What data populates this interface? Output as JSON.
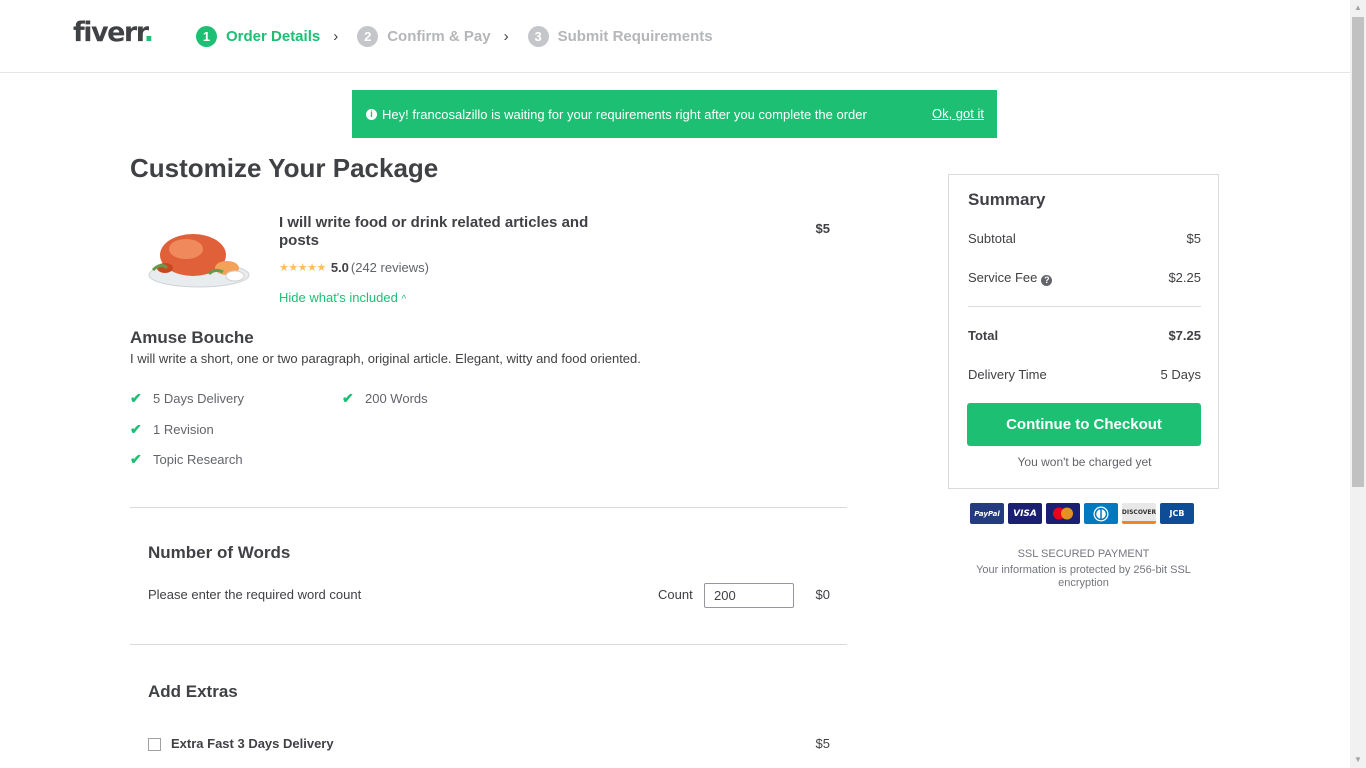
{
  "header": {
    "logo_text": "fiverr",
    "logo_dot": ".",
    "steps": [
      {
        "num": "1",
        "label": "Order Details"
      },
      {
        "num": "2",
        "label": "Confirm & Pay"
      },
      {
        "num": "3",
        "label": "Submit Requirements"
      }
    ],
    "chevron": "›"
  },
  "notice": {
    "icon": "i",
    "text": "Hey! francosalzillo is waiting for your requirements right after you complete the order",
    "dismiss_label": "Ok, got it"
  },
  "page": {
    "title": "Customize Your Package"
  },
  "gig": {
    "title": "I will write food or drink related articles and posts",
    "price": "$5",
    "stars": "★★★★★",
    "rating": "5.0",
    "reviews": "(242 reviews)",
    "toggle_label": "Hide what's included",
    "toggle_icon": "^"
  },
  "package": {
    "name": "Amuse Bouche",
    "description": "I will write a short, one or two paragraph, original article. Elegant, witty and food oriented.",
    "features": [
      "5 Days Delivery",
      "200 Words",
      "1 Revision",
      "Topic Research"
    ]
  },
  "words": {
    "title": "Number of Words",
    "help": "Please enter the required word count",
    "count_label": "Count",
    "count_value": "200",
    "price": "$0"
  },
  "extras": {
    "title": "Add Extras",
    "items": [
      {
        "label": "Extra Fast 3 Days Delivery",
        "price": "$5",
        "checked": false
      }
    ]
  },
  "summary": {
    "title": "Summary",
    "subtotal_label": "Subtotal",
    "subtotal": "$5",
    "fee_label": "Service Fee",
    "fee": "$2.25",
    "total_label": "Total",
    "total": "$7.25",
    "delivery_label": "Delivery Time",
    "delivery": "5 Days",
    "checkout_label": "Continue to Checkout",
    "not_charged": "You won't be charged yet"
  },
  "payment": {
    "cards": [
      {
        "name": "PayPal",
        "color": "#253b80"
      },
      {
        "name": "VISA",
        "color": "#1a1f71"
      },
      {
        "name": "MasterCard",
        "color": "#1a1f71"
      },
      {
        "name": "Diners",
        "color": "#0079be"
      },
      {
        "name": "DISCOVER",
        "color": "#e8e8e8"
      },
      {
        "name": "JCB",
        "color": "#0e4c96"
      }
    ],
    "ssl_title": "SSL SECURED PAYMENT",
    "ssl_text": "Your information is protected by 256-bit SSL encryption"
  },
  "colors": {
    "brand_green": "#1dbf73",
    "text": "#404145"
  }
}
